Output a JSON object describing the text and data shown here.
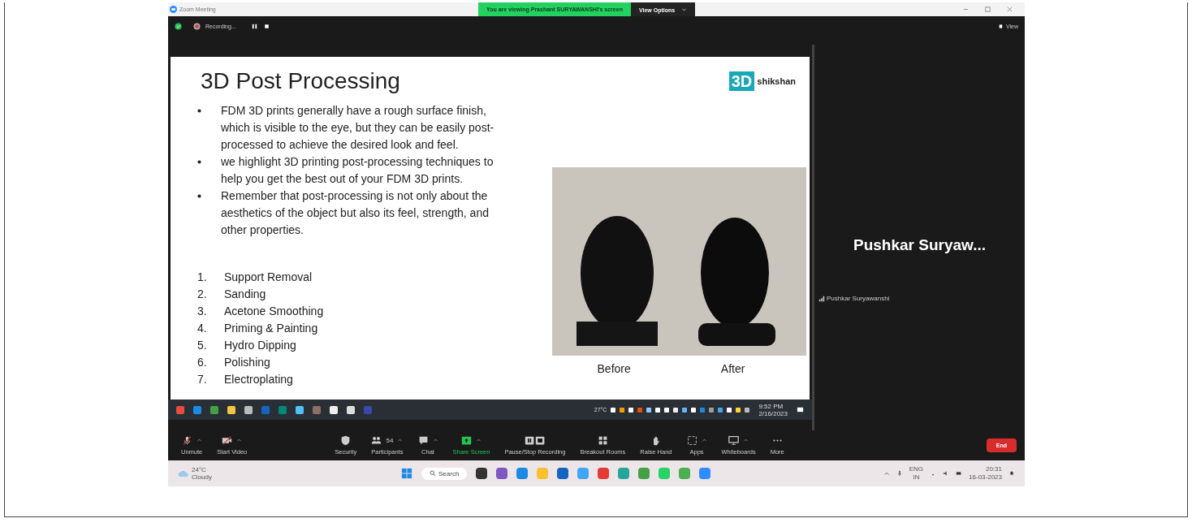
{
  "window": {
    "title": "Zoom Meeting",
    "banner": "You are viewing Prashant SURYAWANSHI's screen",
    "view_options": "View Options"
  },
  "top_bar": {
    "recording_label": "Recording...",
    "view_label": "View"
  },
  "slide": {
    "title": "3D Post Processing",
    "logo_mark": "3D",
    "logo_text": "shikshan",
    "bullets": [
      "FDM 3D prints generally have a rough surface finish, which is visible to the eye, but they can be easily post-processed to achieve the desired look and feel.",
      "we highlight 3D printing post-processing techniques to help you get the best out of your FDM 3D prints.",
      "Remember that post-processing is not only about the aesthetics of the object but also its feel, strength, and other properties."
    ],
    "steps": [
      {
        "number": "1.",
        "text": "Support Removal"
      },
      {
        "number": "2.",
        "text": "Sanding"
      },
      {
        "number": "3.",
        "text": "Acetone Smoothing"
      },
      {
        "number": "4.",
        "text": "Priming & Painting"
      },
      {
        "number": "5.",
        "text": "Hydro Dipping"
      },
      {
        "number": "6.",
        "text": "Polishing"
      },
      {
        "number": "7.",
        "text": "Electroplating"
      }
    ],
    "captions": [
      "Before",
      "After"
    ]
  },
  "shared_taskbar": {
    "weather": "27°C",
    "time": "9:52 PM",
    "date": "2/16/2023"
  },
  "participant": {
    "display_name": "Pushkar  Suryaw...",
    "label": "Pushkar Suryawanshi"
  },
  "toolbar": {
    "left": [
      {
        "kind": "mic",
        "label": "Unmute",
        "menu": true,
        "highlighted": false
      },
      {
        "kind": "video",
        "label": "Start Video",
        "menu": true,
        "highlighted": false
      }
    ],
    "center": [
      {
        "kind": "security",
        "label": "Security",
        "menu": false,
        "highlighted": false
      },
      {
        "kind": "participants",
        "label": "Participants",
        "count": "54",
        "menu": true,
        "highlighted": false
      },
      {
        "kind": "chat",
        "label": "Chat",
        "menu": true,
        "highlighted": false
      },
      {
        "kind": "share",
        "label": "Share Screen",
        "menu": true,
        "highlighted": true
      },
      {
        "kind": "record",
        "label": "Pause/Stop Recording",
        "menu": false,
        "highlighted": false
      },
      {
        "kind": "rooms",
        "label": "Breakout Rooms",
        "menu": false,
        "highlighted": false
      },
      {
        "kind": "hand",
        "label": "Raise Hand",
        "menu": false,
        "highlighted": false
      },
      {
        "kind": "apps",
        "label": "Apps",
        "menu": true,
        "highlighted": false
      },
      {
        "kind": "whiteboard",
        "label": "Whiteboards",
        "menu": true,
        "highlighted": false
      },
      {
        "kind": "more",
        "label": "More",
        "menu": false,
        "highlighted": false
      }
    ]
  },
  "end_button": "End",
  "taskbar": {
    "weather_temp": "24°C",
    "weather_text": "Cloudy",
    "search": "Search",
    "language": "ENG",
    "region": "IN",
    "time": "20:31",
    "date": "16-03-2023"
  }
}
